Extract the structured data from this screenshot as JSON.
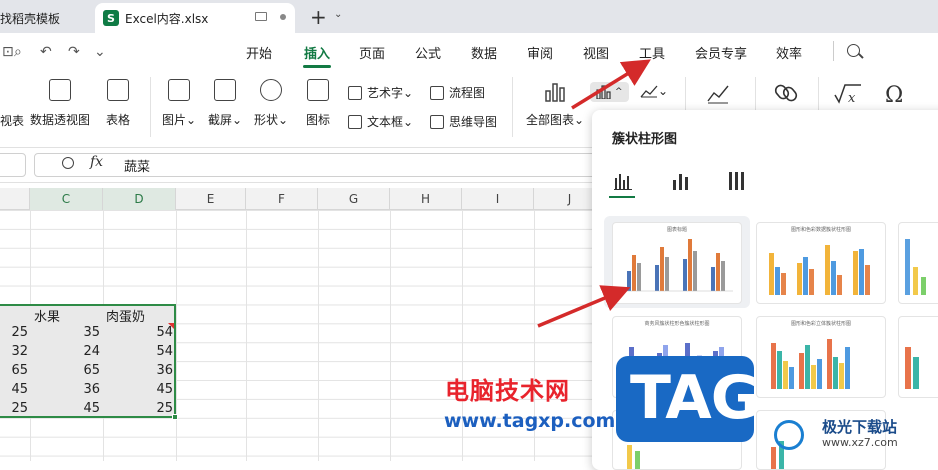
{
  "titlebar": {
    "tab1_label": "找稻壳模板",
    "tab2_badge": "S",
    "tab2_label": "Excel内容.xlsx",
    "new_tab": "+",
    "new_tab_chevron": "⌄"
  },
  "quick_access": [
    "⊡",
    "⌕",
    "↶",
    "↷",
    "⌄"
  ],
  "menu": [
    "开始",
    "插入",
    "页面",
    "公式",
    "数据",
    "审阅",
    "视图",
    "工具",
    "会员专享",
    "效率"
  ],
  "ribbon": {
    "pivot_chart_partial": "视表",
    "pivot_table": "数据透视图",
    "table": "表格",
    "picture": "图片",
    "screenshot": "截屏",
    "shape": "形状",
    "icon": "图标",
    "wordart": "艺术字",
    "textbox": "文本框",
    "flowchart": "流程图",
    "mindmap": "思维导图",
    "all_charts": "全部图表",
    "dropdown_arrow": "⌄",
    "bar_chart_arrow": "^"
  },
  "formula_bar": {
    "fx": "fx",
    "value": "蔬菜"
  },
  "columns": [
    "C",
    "D",
    "E",
    "F",
    "G",
    "H",
    "I",
    "J"
  ],
  "table": {
    "headers": [
      "水果",
      "肉蛋奶"
    ],
    "rows": [
      [
        "25",
        "35",
        "54"
      ],
      [
        "32",
        "24",
        "54"
      ],
      [
        "65",
        "65",
        "36"
      ],
      [
        "45",
        "36",
        "45"
      ],
      [
        "25",
        "45",
        "25"
      ]
    ]
  },
  "panel": {
    "title": "簇状柱形图",
    "thumb_titles": [
      "图表标题",
      "图形和色彩数据簇状柱形图",
      "商务风簇状柱形色簇状柱形图",
      "图形和色彩立体簇状柱形图"
    ]
  },
  "watermark": {
    "cn": "电脑技术网",
    "url": "www.tagxp.com",
    "tag": "TAG",
    "site_name": "极光下载站",
    "site_url": "www.xz7.com"
  },
  "colors": {
    "accent_green": "#137a44",
    "selection_border": "#2e8b46",
    "arrow_red": "#d42a2a",
    "tag_blue": "#1969c4"
  }
}
